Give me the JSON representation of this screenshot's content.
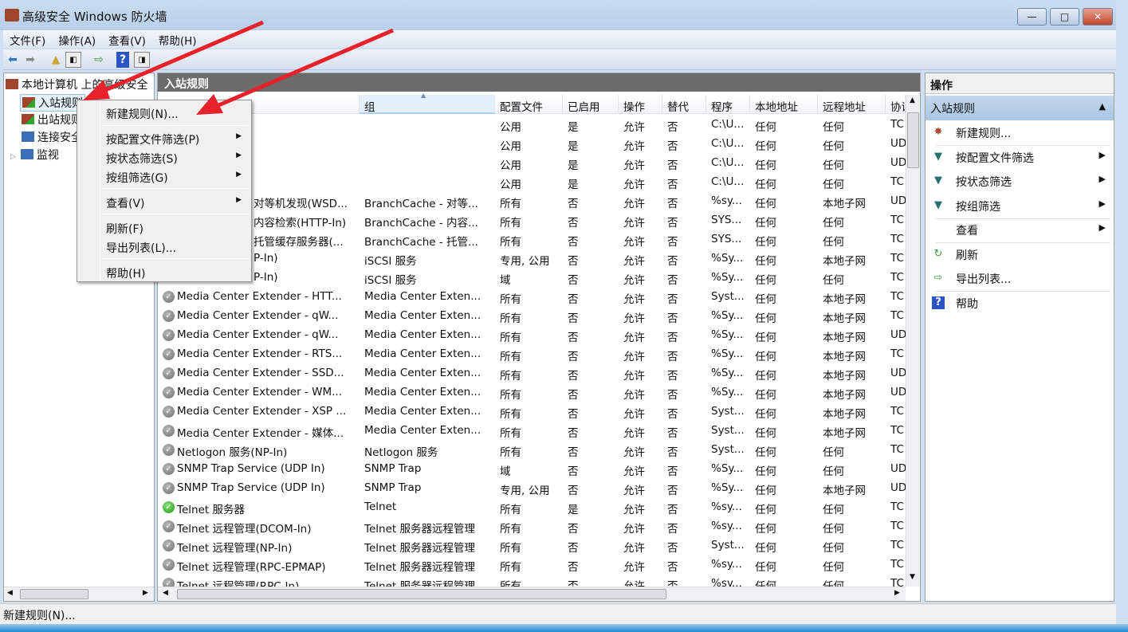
{
  "window": {
    "title": "高级安全 Windows 防火墙",
    "minimize": "—",
    "maximize": "□",
    "close": "✕"
  },
  "menubar": [
    "文件(F)",
    "操作(A)",
    "查看(V)",
    "帮助(H)"
  ],
  "tree": {
    "root": "本地计算机 上的高级安全",
    "items": [
      "入站规则",
      "出站规则",
      "连接安全",
      "监视"
    ]
  },
  "center": {
    "title": "入站规则",
    "columns": [
      "",
      "组",
      "配置文件",
      "已启用",
      "操作",
      "替代",
      "程序",
      "本地地址",
      "远程地址",
      "协议"
    ],
    "rows": [
      [
        "",
        "",
        "公用",
        "是",
        "允许",
        "否",
        "C:\\U...",
        "任何",
        "任何",
        "TC",
        ""
      ],
      [
        "",
        "",
        "公用",
        "是",
        "允许",
        "否",
        "C:\\U...",
        "任何",
        "任何",
        "UD",
        ""
      ],
      [
        "",
        "",
        "公用",
        "是",
        "允许",
        "否",
        "C:\\U...",
        "任何",
        "任何",
        "UD",
        ""
      ],
      [
        "",
        "",
        "公用",
        "是",
        "允许",
        "否",
        "C:\\U...",
        "任何",
        "任何",
        "TC",
        ""
      ],
      [
        "对等机发现(WSD...",
        "BranchCache - 对等...",
        "所有",
        "否",
        "允许",
        "否",
        "%sy...",
        "任何",
        "本地子网",
        "UD",
        "partial"
      ],
      [
        "内容检索(HTTP-In)",
        "BranchCache - 内容...",
        "所有",
        "否",
        "允许",
        "否",
        "SYS...",
        "任何",
        "任何",
        "TC",
        "partial"
      ],
      [
        "托管缓存服务器(...",
        "BranchCache - 托管...",
        "所有",
        "否",
        "允许",
        "否",
        "SYS...",
        "任何",
        "任何",
        "TC",
        "partial"
      ],
      [
        "P-In)",
        "iSCSI 服务",
        "专用, 公用",
        "否",
        "允许",
        "否",
        "%Sy...",
        "任何",
        "本地子网",
        "TC",
        "partial"
      ],
      [
        "P-In)",
        "iSCSI 服务",
        "域",
        "否",
        "允许",
        "否",
        "%Sy...",
        "任何",
        "任何",
        "TC",
        "partial"
      ],
      [
        "Media Center Extender - HTT...",
        "Media Center Exten...",
        "所有",
        "否",
        "允许",
        "否",
        "Syst...",
        "任何",
        "本地子网",
        "TC",
        "off"
      ],
      [
        "Media Center Extender - qW...",
        "Media Center Exten...",
        "所有",
        "否",
        "允许",
        "否",
        "%Sy...",
        "任何",
        "本地子网",
        "TC",
        "off"
      ],
      [
        "Media Center Extender - qW...",
        "Media Center Exten...",
        "所有",
        "否",
        "允许",
        "否",
        "%Sy...",
        "任何",
        "本地子网",
        "UD",
        "off"
      ],
      [
        "Media Center Extender - RTS...",
        "Media Center Exten...",
        "所有",
        "否",
        "允许",
        "否",
        "%Sy...",
        "任何",
        "本地子网",
        "TC",
        "off"
      ],
      [
        "Media Center Extender - SSD...",
        "Media Center Exten...",
        "所有",
        "否",
        "允许",
        "否",
        "%Sy...",
        "任何",
        "本地子网",
        "UD",
        "off"
      ],
      [
        "Media Center Extender - WM...",
        "Media Center Exten...",
        "所有",
        "否",
        "允许",
        "否",
        "%Sy...",
        "任何",
        "本地子网",
        "UD",
        "off"
      ],
      [
        "Media Center Extender - XSP ...",
        "Media Center Exten...",
        "所有",
        "否",
        "允许",
        "否",
        "Syst...",
        "任何",
        "本地子网",
        "TC",
        "off"
      ],
      [
        "Media Center Extender - 媒体...",
        "Media Center Exten...",
        "所有",
        "否",
        "允许",
        "否",
        "Syst...",
        "任何",
        "本地子网",
        "TC",
        "off"
      ],
      [
        "Netlogon 服务(NP-In)",
        "Netlogon 服务",
        "所有",
        "否",
        "允许",
        "否",
        "Syst...",
        "任何",
        "任何",
        "TC",
        "off"
      ],
      [
        "SNMP Trap Service (UDP In)",
        "SNMP Trap",
        "域",
        "否",
        "允许",
        "否",
        "%Sy...",
        "任何",
        "任何",
        "UD",
        "off"
      ],
      [
        "SNMP Trap Service (UDP In)",
        "SNMP Trap",
        "专用, 公用",
        "否",
        "允许",
        "否",
        "%Sy...",
        "任何",
        "本地子网",
        "UD",
        "off"
      ],
      [
        "Telnet 服务器",
        "Telnet",
        "所有",
        "是",
        "允许",
        "否",
        "%sy...",
        "任何",
        "任何",
        "TC",
        "on"
      ],
      [
        "Telnet 远程管理(DCOM-In)",
        "Telnet 服务器远程管理",
        "所有",
        "否",
        "允许",
        "否",
        "%sy...",
        "任何",
        "任何",
        "TC",
        "off"
      ],
      [
        "Telnet 远程管理(NP-In)",
        "Telnet 服务器远程管理",
        "所有",
        "否",
        "允许",
        "否",
        "Syst...",
        "任何",
        "任何",
        "TC",
        "off"
      ],
      [
        "Telnet 远程管理(RPC-EPMAP)",
        "Telnet 服务器远程管理",
        "所有",
        "否",
        "允许",
        "否",
        "%sy...",
        "任何",
        "任何",
        "TC",
        "off"
      ],
      [
        "Telnet 远程管理(RPC-In)",
        "Telnet 服务器远程管理",
        "所有",
        "否",
        "允许",
        "否",
        "%sy...",
        "任何",
        "任何",
        "TC",
        "off"
      ]
    ]
  },
  "actions": {
    "header": "操作",
    "section": "入站规则",
    "items": [
      "新建规则...",
      "按配置文件筛选",
      "按状态筛选",
      "按组筛选",
      "查看",
      "刷新",
      "导出列表...",
      "帮助"
    ]
  },
  "context_menu": [
    "新建规则(N)...",
    "按配置文件筛选(P)",
    "按状态筛选(S)",
    "按组筛选(G)",
    "查看(V)",
    "刷新(F)",
    "导出列表(L)...",
    "帮助(H)"
  ],
  "status": "新建规则(N)...",
  "colors": {
    "arrow": "#e8212b",
    "header_bar": "#6b6b6b",
    "section": "#b4cde6"
  }
}
